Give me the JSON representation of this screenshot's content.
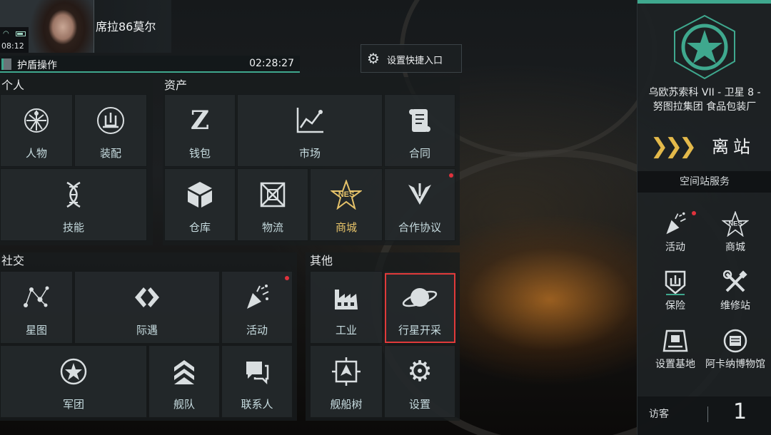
{
  "status": {
    "time": "08:12"
  },
  "player": {
    "name": "席拉86莫尔"
  },
  "mission": {
    "label": "护盾操作",
    "timer": "02:28:27"
  },
  "shortcut": {
    "label": "设置快捷入口",
    "icon": "gear-icon"
  },
  "sections": {
    "personal": {
      "title": "个人",
      "tiles": [
        {
          "label": "人物",
          "icon": "vitruvian-icon"
        },
        {
          "label": "装配",
          "icon": "fitting-icon"
        },
        {
          "label": "技能",
          "icon": "dna-icon"
        }
      ]
    },
    "assets": {
      "title": "资产",
      "tiles": [
        {
          "label": "钱包",
          "icon": "wallet-z-icon"
        },
        {
          "label": "市场",
          "icon": "market-chart-icon"
        },
        {
          "label": "合同",
          "icon": "contract-scroll-icon"
        },
        {
          "label": "仓库",
          "icon": "cube-icon"
        },
        {
          "label": "物流",
          "icon": "logistics-box-icon"
        },
        {
          "label": "商城",
          "icon": "nes-star-icon"
        },
        {
          "label": "合作协议",
          "icon": "agreement-wing-icon"
        }
      ]
    },
    "social": {
      "title": "社交",
      "tiles": [
        {
          "label": "星图",
          "icon": "starmap-icon"
        },
        {
          "label": "际遇",
          "icon": "encounter-icon"
        },
        {
          "label": "活动",
          "icon": "party-popper-icon"
        },
        {
          "label": "军团",
          "icon": "corp-star-icon"
        },
        {
          "label": "舰队",
          "icon": "fleet-chevrons-icon"
        },
        {
          "label": "联系人",
          "icon": "chat-icon"
        }
      ]
    },
    "other": {
      "title": "其他",
      "tiles": [
        {
          "label": "工业",
          "icon": "factory-icon"
        },
        {
          "label": "行星开采",
          "icon": "planet-icon"
        },
        {
          "label": "舰船树",
          "icon": "ship-tree-icon"
        },
        {
          "label": "设置",
          "icon": "gear-icon"
        }
      ]
    }
  },
  "sidebar": {
    "station_name_line1": "乌欧苏索科 VII - 卫星 8 -",
    "station_name_line2": "努图拉集团 食品包装厂",
    "undock_label": "离站",
    "services_title": "空间站服务",
    "services": [
      {
        "label": "活动",
        "icon": "party-popper-icon"
      },
      {
        "label": "商城",
        "icon": "nes-star-icon"
      },
      {
        "label": "保险",
        "icon": "insurance-shield-icon"
      },
      {
        "label": "维修站",
        "icon": "wrench-screwdriver-icon"
      },
      {
        "label": "设置基地",
        "icon": "base-terminal-icon"
      },
      {
        "label": "阿卡纳博物馆",
        "icon": "museum-badge-icon"
      }
    ],
    "visitor_label": "访客",
    "visitor_count": "1"
  },
  "colors": {
    "accent": "#3fa88e",
    "gold": "#e6c36a",
    "alert": "#e0323c",
    "highlight_border": "#e03a3a"
  }
}
